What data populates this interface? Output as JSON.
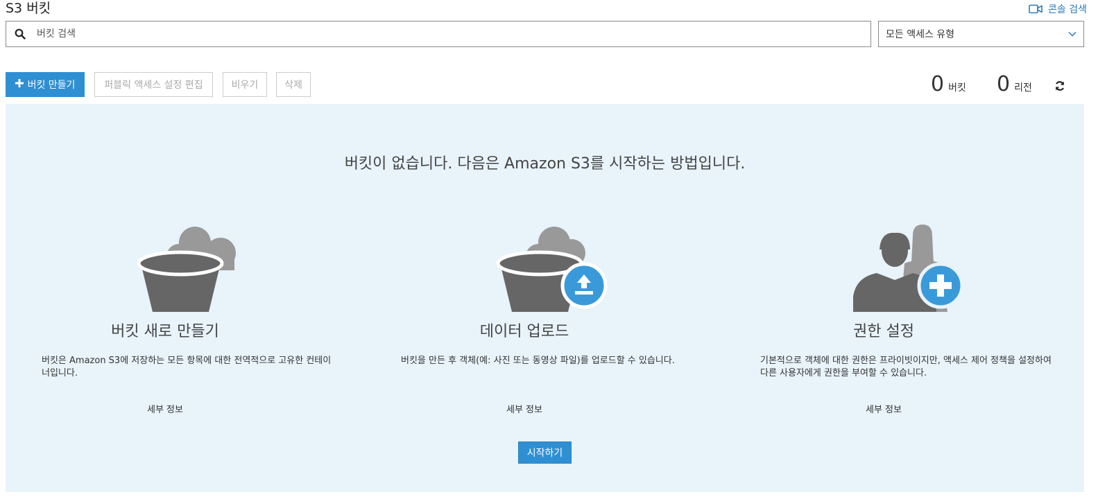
{
  "page": {
    "title": "S3 버킷"
  },
  "header": {
    "console_search_label": "콘솔 검색"
  },
  "search": {
    "placeholder": "버킷 검색",
    "value": ""
  },
  "access_filter": {
    "selected": "모든 액세스 유형"
  },
  "toolbar": {
    "create_bucket_label": "버킷 만들기",
    "edit_public_access_label": "퍼블릭 액세스 설정 편집",
    "empty_label": "비우기",
    "delete_label": "삭제"
  },
  "stats": {
    "bucket_count": "0",
    "bucket_label": "버킷",
    "region_count": "0",
    "region_label": "리전"
  },
  "empty_state": {
    "headline": "버킷이 없습니다. 다음은 Amazon S3를 시작하는 방법입니다.",
    "cards": [
      {
        "title": "버킷 새로 만들기",
        "description": "버킷은 Amazon S3에 저장하는 모든 항목에 대한 전역적으로 고유한 컨테이너입니다.",
        "link": "세부 정보",
        "icon": "bucket-cloud-icon"
      },
      {
        "title": "데이터 업로드",
        "description": "버킷을 만든 후 객체(예: 사진 또는 동영상 파일)를 업로드할 수 있습니다.",
        "link": "세부 정보",
        "icon": "bucket-upload-icon"
      },
      {
        "title": "권한 설정",
        "description": "기본적으로 객체에 대한 권한은 프라이빗이지만, 액세스 제어 정책을 설정하여 다른 사용자에게 권한을 부여할 수 있습니다.",
        "link": "세부 정보",
        "icon": "users-add-icon"
      }
    ],
    "start_button_label": "시작하기"
  },
  "colors": {
    "accent": "#2f8fd3",
    "panel_bg": "#e8f3fa",
    "illustration_dark": "#666666",
    "illustration_light": "#999999",
    "badge_blue": "#3a9ad9"
  }
}
